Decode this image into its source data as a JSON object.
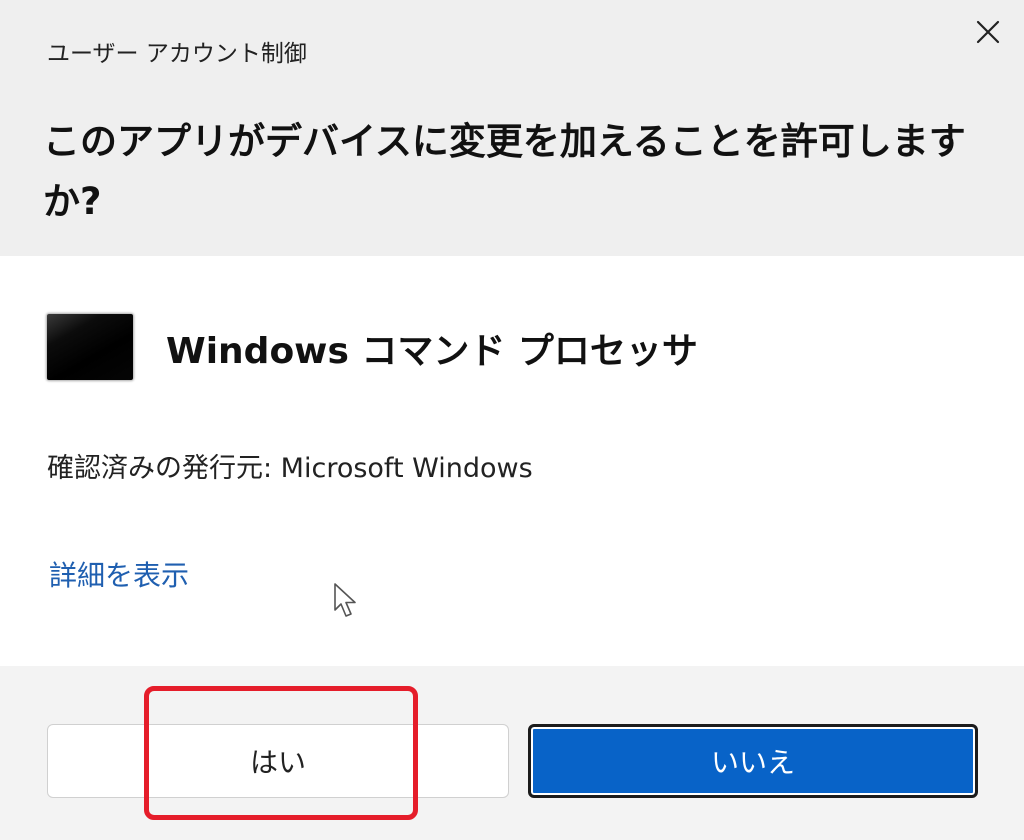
{
  "dialog": {
    "title": "ユーザー アカウント制御",
    "question": "このアプリがデバイスに変更を加えることを許可しますか?",
    "close_icon": "close-icon"
  },
  "app": {
    "icon": "command-prompt-icon",
    "name": "Windows コマンド プロセッサ",
    "publisher": "確認済みの発行元: Microsoft Windows"
  },
  "details_link": "詳細を表示",
  "buttons": {
    "yes_label": "はい",
    "no_label": "いいえ"
  },
  "colors": {
    "accent": "#0863c8",
    "highlight": "#e51d2a",
    "link": "#1f5fb0",
    "header_bg": "#efefef"
  }
}
